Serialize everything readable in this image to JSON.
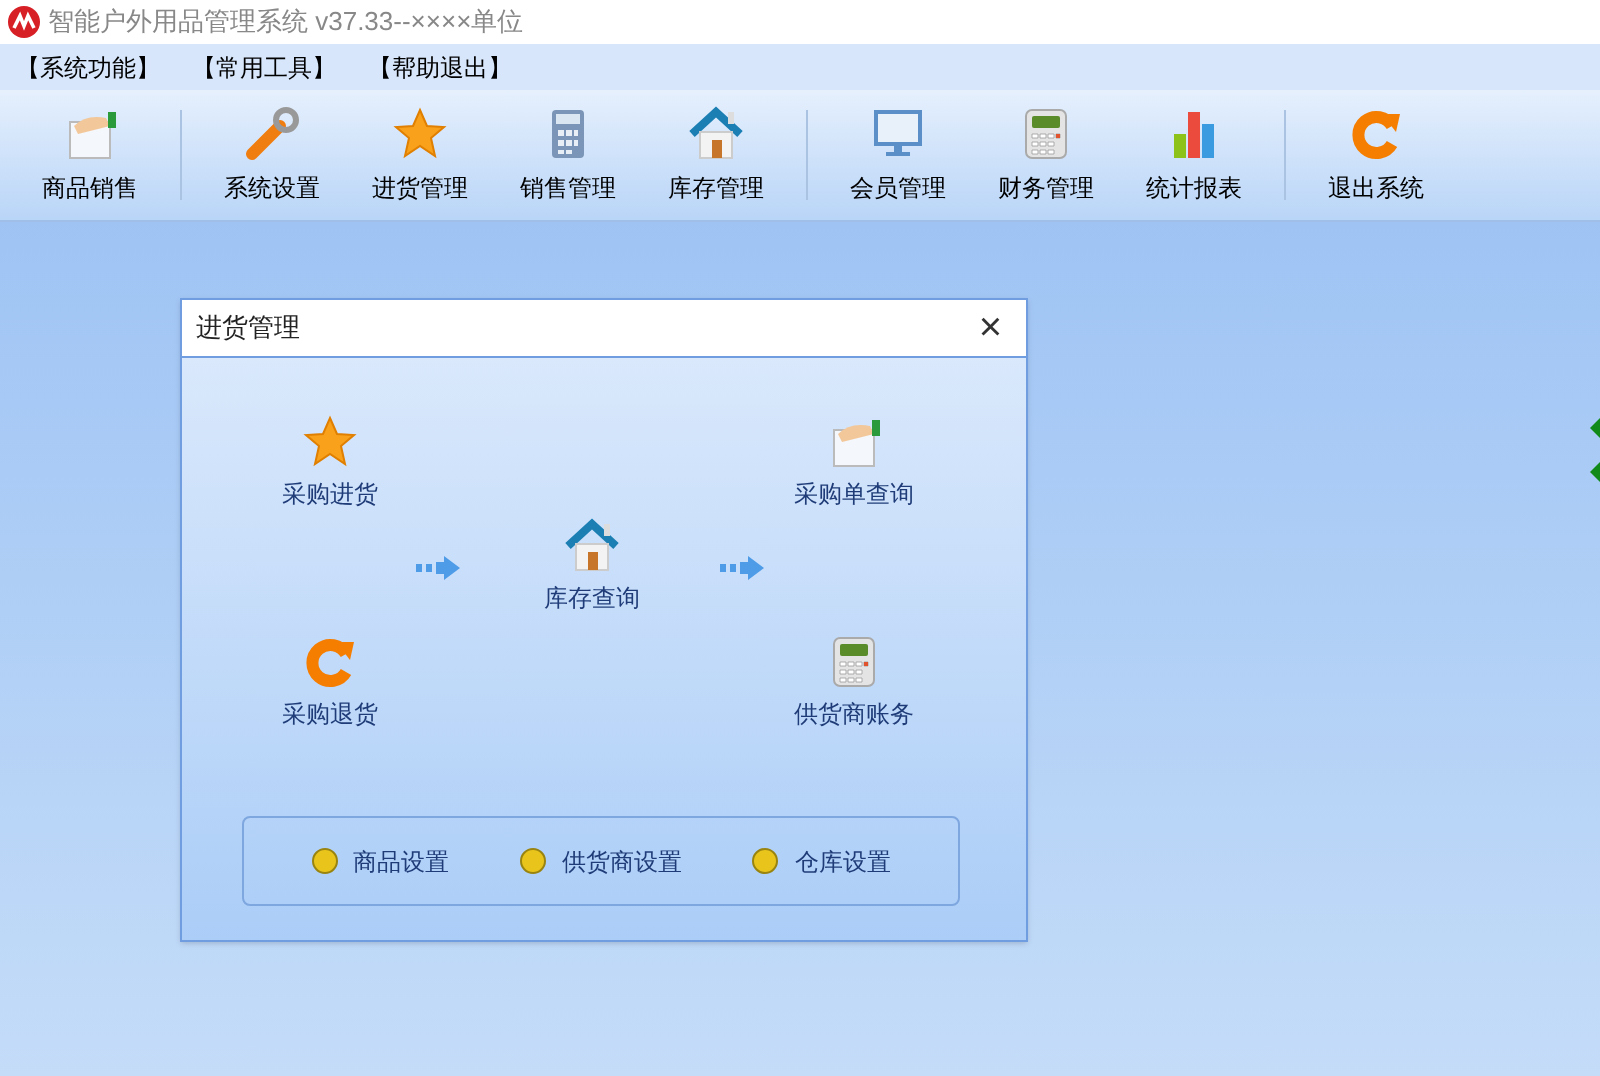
{
  "window": {
    "title": "智能户外用品管理系统 v37.33--××××单位"
  },
  "menu": [
    "【系统功能】",
    "【常用工具】",
    "【帮助退出】"
  ],
  "toolbar": [
    [
      {
        "label": "商品销售"
      }
    ],
    [
      {
        "label": "系统设置"
      },
      {
        "label": "进货管理"
      },
      {
        "label": "销售管理"
      },
      {
        "label": "库存管理"
      }
    ],
    [
      {
        "label": "会员管理"
      },
      {
        "label": "财务管理"
      },
      {
        "label": "统计报表"
      }
    ],
    [
      {
        "label": "退出系统"
      }
    ]
  ],
  "dialog": {
    "title": "进货管理",
    "close": "×",
    "nodes": [
      {
        "kind": "star",
        "label": "采购进货"
      },
      {
        "kind": "hand",
        "label": "采购单查询"
      },
      {
        "kind": "house",
        "label": "库存查询"
      },
      {
        "kind": "refresh",
        "label": "采购退货"
      },
      {
        "kind": "calculator",
        "label": "供货商账务"
      }
    ],
    "settings": [
      "商品设置",
      "供货商设置",
      "仓库设置"
    ]
  }
}
